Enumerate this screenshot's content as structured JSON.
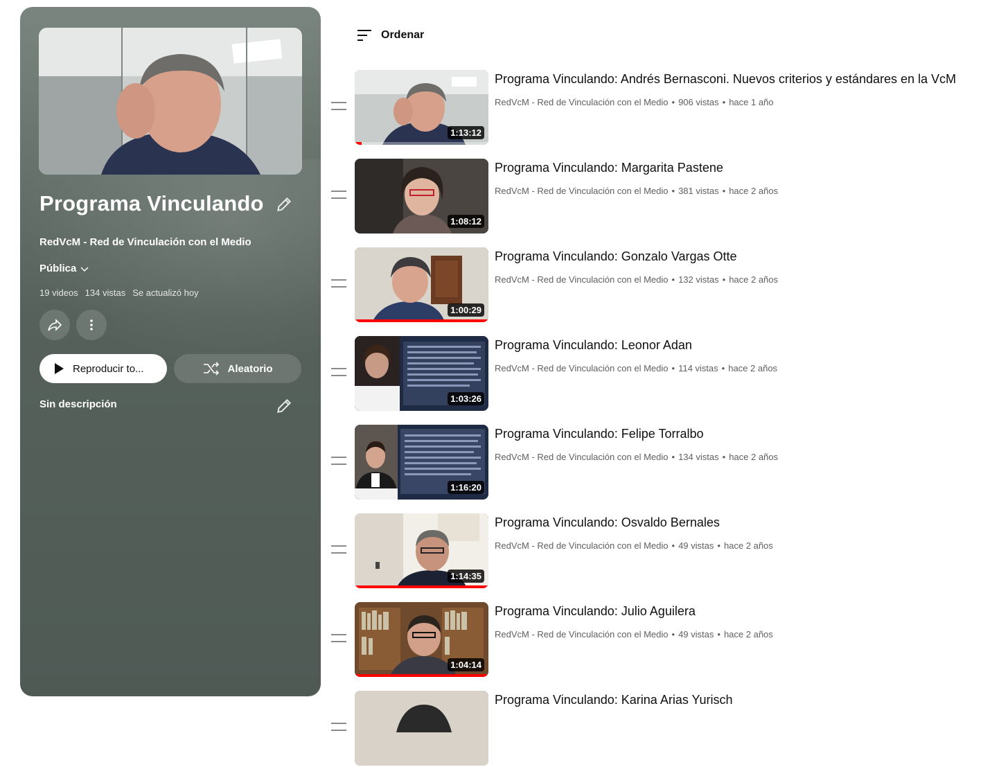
{
  "playlist": {
    "title": "Programa Vinculando",
    "channel": "RedVcM - Red de Vinculación con el Medio",
    "privacy": "Pública",
    "stats": {
      "videos": "19 videos",
      "views": "134 vistas",
      "updated": "Se actualizó hoy"
    },
    "play_all_label": "Reproducir to...",
    "shuffle_label": "Aleatorio",
    "description": "Sin descripción"
  },
  "sort_label": "Ordenar",
  "videos": [
    {
      "title": "Programa Vinculando: Andrés Bernasconi. Nuevos criterios y estándares en la VcM",
      "channel": "RedVcM - Red de Vinculación con el Medio",
      "views": "906 vistas",
      "age": "hace 1 año",
      "duration": "1:13:12",
      "watched": 0.05
    },
    {
      "title": "Programa Vinculando: Margarita Pastene",
      "channel": "RedVcM - Red de Vinculación con el Medio",
      "views": "381 vistas",
      "age": "hace 2 años",
      "duration": "1:08:12",
      "watched": 0.0
    },
    {
      "title": "Programa Vinculando: Gonzalo Vargas Otte",
      "channel": "RedVcM - Red de Vinculación con el Medio",
      "views": "132 vistas",
      "age": "hace 2 años",
      "duration": "1:00:29",
      "watched": 1.0
    },
    {
      "title": "Programa Vinculando: Leonor Adan",
      "channel": "RedVcM - Red de Vinculación con el Medio",
      "views": "114 vistas",
      "age": "hace 2 años",
      "duration": "1:03:26",
      "watched": 0.0
    },
    {
      "title": "Programa Vinculando: Felipe Torralbo",
      "channel": "RedVcM - Red de Vinculación con el Medio",
      "views": "134 vistas",
      "age": "hace 2 años",
      "duration": "1:16:20",
      "watched": 0.0
    },
    {
      "title": "Programa Vinculando: Osvaldo Bernales",
      "channel": "RedVcM - Red de Vinculación con el Medio",
      "views": "49 vistas",
      "age": "hace 2 años",
      "duration": "1:14:35",
      "watched": 1.0
    },
    {
      "title": "Programa Vinculando: Julio Aguilera",
      "channel": "RedVcM - Red de Vinculación con el Medio",
      "views": "49 vistas",
      "age": "hace 2 años",
      "duration": "1:04:14",
      "watched": 1.0
    },
    {
      "title": "Programa Vinculando: Karina Arias Yurisch",
      "channel": "",
      "views": "",
      "age": "",
      "duration": "",
      "watched": 0.0
    }
  ],
  "colors": {
    "panel": "#56615b",
    "progress": "#ff0000",
    "meta_text": "#606060"
  }
}
